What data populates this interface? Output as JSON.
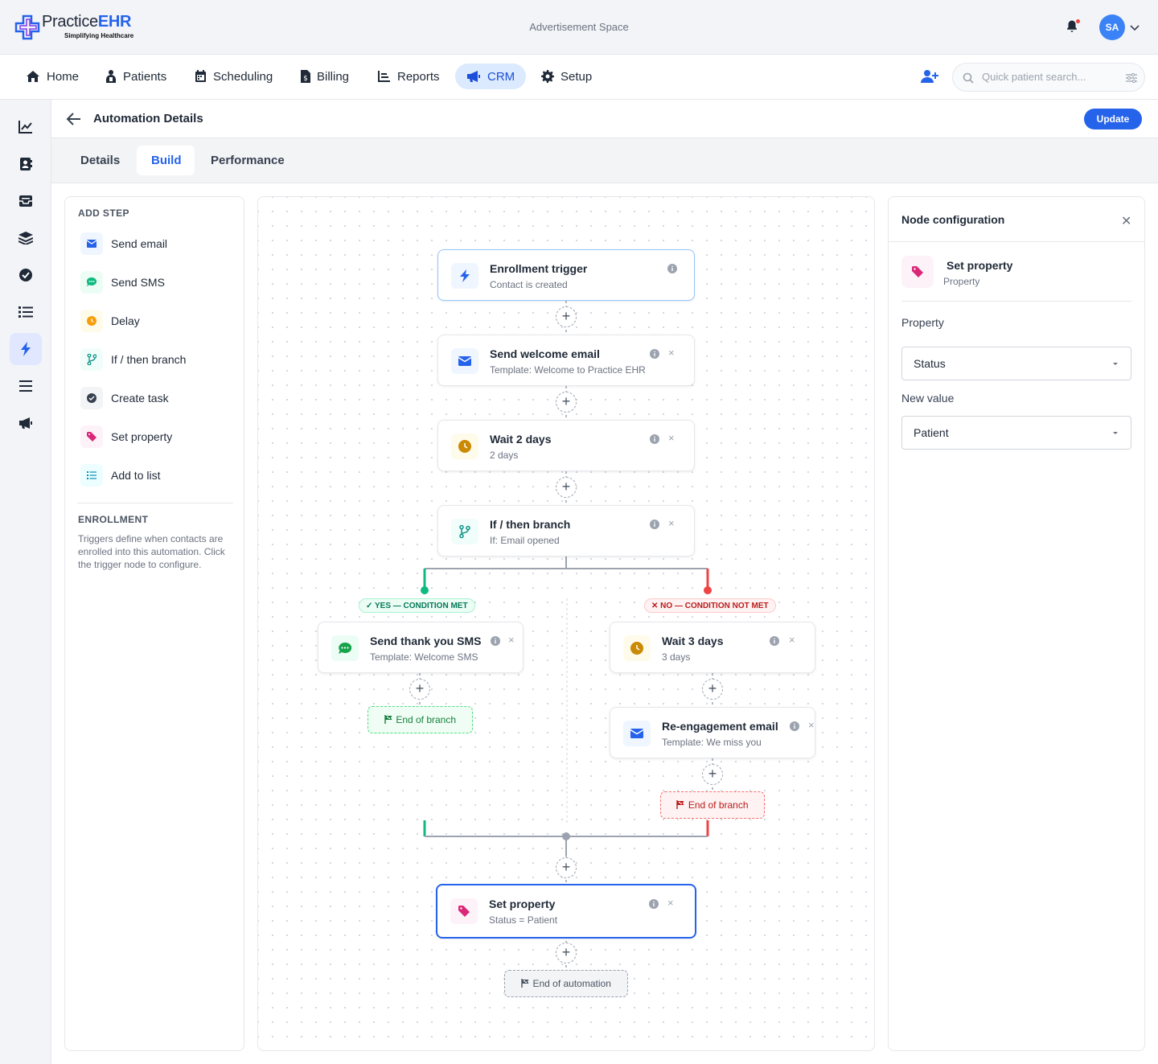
{
  "header": {
    "brand_main": "Practice",
    "brand_accent": "EHR",
    "tagline": "Simplifying Healthcare",
    "ad_text": "Advertisement Space",
    "avatar_initials": "SA",
    "bell_icon": "bell-icon"
  },
  "nav": {
    "items": [
      {
        "label": "Home",
        "icon": "home-icon"
      },
      {
        "label": "Patients",
        "icon": "patients-icon"
      },
      {
        "label": "Scheduling",
        "icon": "calendar-icon"
      },
      {
        "label": "Billing",
        "icon": "billing-icon"
      },
      {
        "label": "Reports",
        "icon": "reports-icon"
      },
      {
        "label": "CRM",
        "icon": "megaphone-icon",
        "active": true
      },
      {
        "label": "Setup",
        "icon": "gear-icon"
      }
    ],
    "search_placeholder": "Quick patient search..."
  },
  "sidebar": {
    "icons": [
      "chart-line-icon",
      "contact-book-icon",
      "inbox-icon",
      "layers-icon",
      "check-circle-icon",
      "list-icon",
      "bolt-icon",
      "menu-icon",
      "megaphone-icon"
    ],
    "active_index": 6
  },
  "page": {
    "title": "Automation Details",
    "update_label": "Update",
    "tabs": [
      "Details",
      "Build",
      "Performance"
    ],
    "active_tab": "Build"
  },
  "add_step": {
    "title": "ADD STEP",
    "items": [
      {
        "label": "Send email",
        "icon": "envelope-icon"
      },
      {
        "label": "Send SMS",
        "icon": "chat-icon"
      },
      {
        "label": "Delay",
        "icon": "clock-icon"
      },
      {
        "label": "If / then branch",
        "icon": "branch-icon"
      },
      {
        "label": "Create task",
        "icon": "task-icon"
      },
      {
        "label": "Set property",
        "icon": "tag-icon"
      },
      {
        "label": "Add to list",
        "icon": "list-icon"
      }
    ],
    "enrollment_title": "ENROLLMENT",
    "enrollment_text": "Triggers define when contacts are enrolled into this automation. Click the trigger node to configure."
  },
  "flow": {
    "trigger": {
      "title": "Enrollment trigger",
      "subtitle": "Contact is created"
    },
    "welcome": {
      "title": "Send welcome email",
      "subtitle": "Template: Welcome to Practice EHR"
    },
    "wait2": {
      "title": "Wait 2 days",
      "subtitle": "2 days"
    },
    "branch": {
      "title": "If / then branch",
      "subtitle": "If: Email opened"
    },
    "yes_label": "YES — CONDITION MET",
    "no_label": "NO — CONDITION NOT MET",
    "thanks_sms": {
      "title": "Send thank you SMS",
      "subtitle": "Template: Welcome SMS"
    },
    "wait3": {
      "title": "Wait 3 days",
      "subtitle": "3 days"
    },
    "reengage": {
      "title": "Re-engagement email",
      "subtitle": "Template: We miss you"
    },
    "end_branch_yes": "End of branch",
    "end_branch_no": "End of branch",
    "set_property": {
      "title": "Set property",
      "subtitle": "Status = Patient"
    },
    "end_automation": "End of automation",
    "plus_symbol": "+",
    "close_symbol": "×"
  },
  "config": {
    "title": "Node configuration",
    "node_name": "Set property",
    "node_type": "Property",
    "property_label": "Property",
    "property_value": "Status",
    "new_value_label": "New value",
    "new_value": "Patient",
    "close_symbol": "✕"
  },
  "colors": {
    "primary": "#2563eb",
    "yes": "#10b981",
    "no": "#ef4444"
  }
}
